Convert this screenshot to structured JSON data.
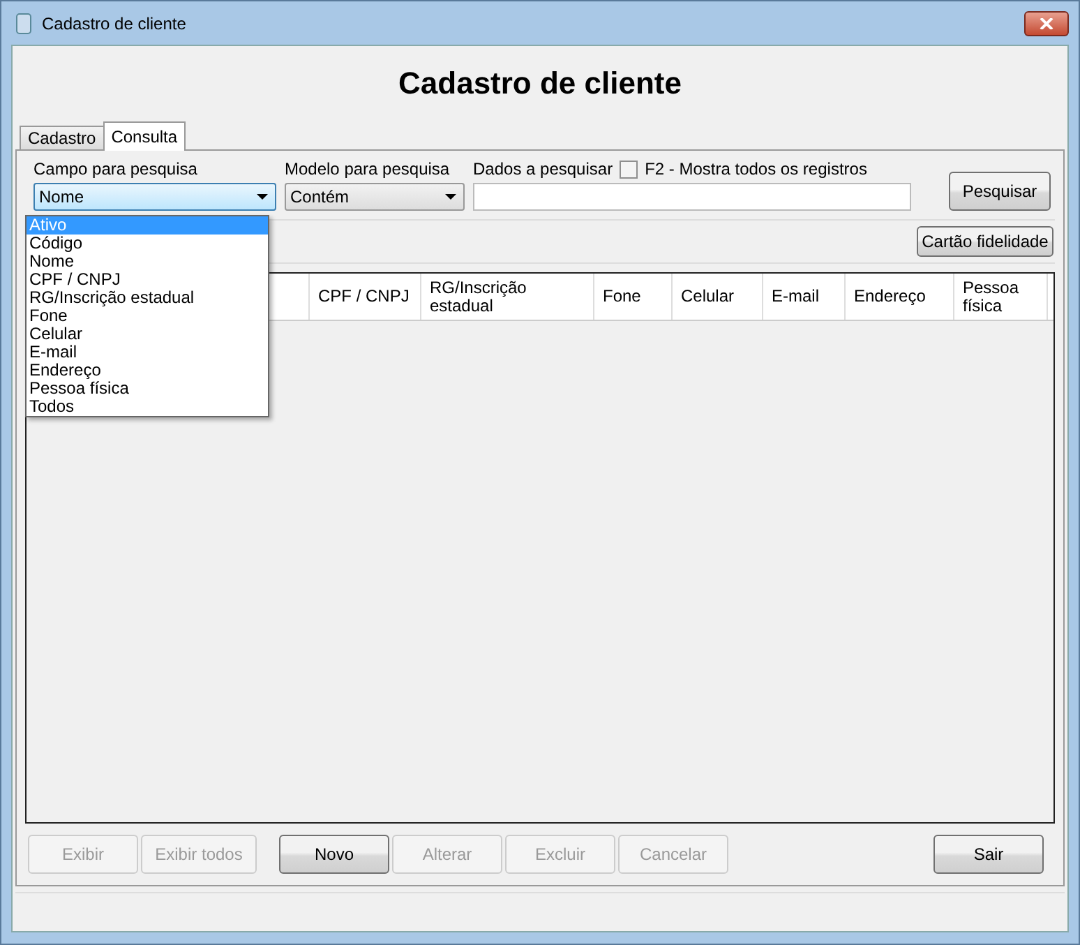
{
  "window": {
    "title": "Cadastro de cliente"
  },
  "heading": "Cadastro de cliente",
  "tabs": [
    {
      "label": "Cadastro",
      "selected": false
    },
    {
      "label": "Consulta",
      "selected": true
    }
  ],
  "search": {
    "field_label": "Campo para pesquisa",
    "field_value": "Nome",
    "model_label": "Modelo para pesquisa",
    "model_value": "Contém",
    "data_label": "Dados a pesquisar",
    "show_all": {
      "label": "F2 - Mostra todos os registros",
      "checked": false
    },
    "search_button": "Pesquisar"
  },
  "field_options": [
    {
      "label": "Ativo",
      "selected": true
    },
    {
      "label": "Código",
      "selected": false
    },
    {
      "label": "Nome",
      "selected": false
    },
    {
      "label": "CPF / CNPJ",
      "selected": false
    },
    {
      "label": "RG/Inscrição estadual",
      "selected": false
    },
    {
      "label": "Fone",
      "selected": false
    },
    {
      "label": "Celular",
      "selected": false
    },
    {
      "label": "E-mail",
      "selected": false
    },
    {
      "label": "Endereço",
      "selected": false
    },
    {
      "label": "Pessoa física",
      "selected": false
    },
    {
      "label": "Todos",
      "selected": false
    }
  ],
  "loyalty_button": "Cartão fidelidade",
  "table": {
    "columns": [
      "CPF / CNPJ",
      "RG/Inscrição estadual",
      "Fone",
      "Celular",
      "E-mail",
      "Endereço",
      "Pessoa física"
    ]
  },
  "actions": [
    {
      "label": "Exibir",
      "disabled": true
    },
    {
      "label": "Exibir todos",
      "disabled": true
    },
    {
      "label": "Novo",
      "disabled": false
    },
    {
      "label": "Alterar",
      "disabled": true
    },
    {
      "label": "Excluir",
      "disabled": true
    },
    {
      "label": "Cancelar",
      "disabled": true
    }
  ],
  "exit_button": "Sair"
}
